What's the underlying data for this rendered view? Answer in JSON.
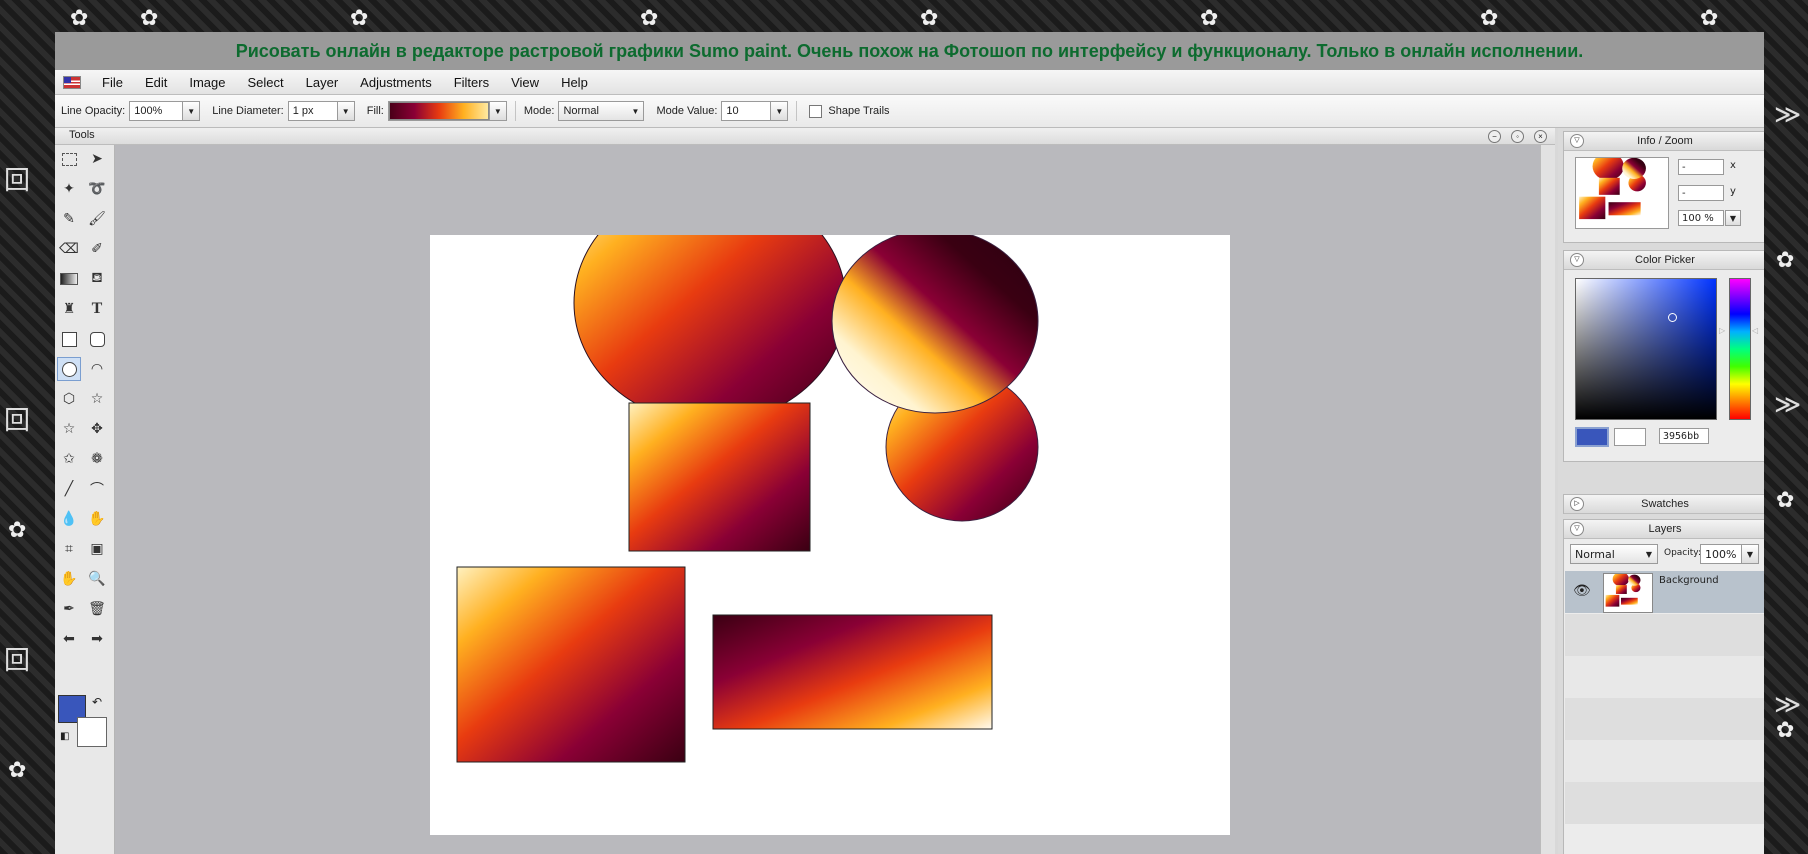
{
  "banner": {
    "text": "Рисовать онлайн в редакторе растровой графики Sumo paint. Очень похож на Фотошоп по интерфейсу и функционалу. Только в онлайн исполнении."
  },
  "menu": {
    "items": [
      "File",
      "Edit",
      "Image",
      "Select",
      "Layer",
      "Adjustments",
      "Filters",
      "View",
      "Help"
    ]
  },
  "options": {
    "line_opacity_label": "Line Opacity:",
    "line_opacity_value": "100%",
    "line_diameter_label": "Line Diameter:",
    "line_diameter_value": "1 px",
    "fill_label": "Fill:",
    "mode_label": "Mode:",
    "mode_value": "Normal",
    "mode_value_label": "Mode Value:",
    "mode_value_value": "10",
    "shape_trails_label": "Shape Trails"
  },
  "tools_panel": {
    "title": "Tools"
  },
  "colors": {
    "foreground": "#3956bb",
    "background": "#ffffff",
    "gradient": [
      "#4a0018",
      "#8a0035",
      "#e83b10",
      "#ffb020",
      "#fff1c0"
    ]
  },
  "info_zoom": {
    "title": "Info / Zoom",
    "x_value": "-",
    "x_label": "x",
    "y_value": "-",
    "y_label": "y",
    "zoom_value": "100 %"
  },
  "color_picker": {
    "title": "Color Picker",
    "hex_value": "3956bb"
  },
  "swatches": {
    "title": "Swatches"
  },
  "layers": {
    "title": "Layers",
    "blend_mode": "Normal",
    "opacity_label": "Opacity:",
    "opacity_value": "100%",
    "items": [
      {
        "name": "Background"
      }
    ]
  }
}
